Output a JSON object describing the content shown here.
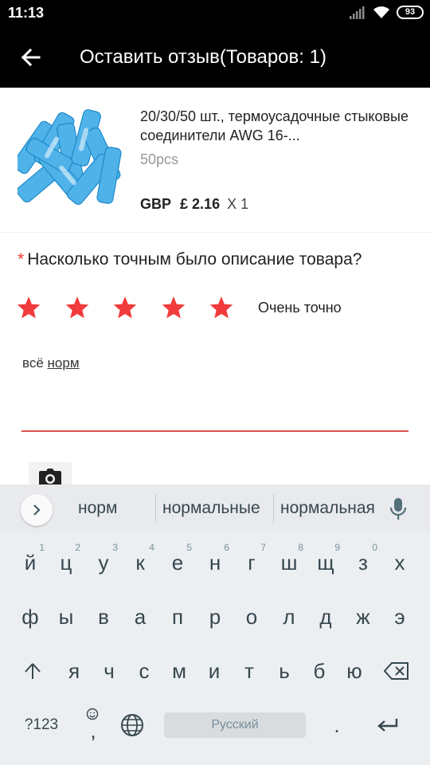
{
  "status_bar": {
    "time": "11:13",
    "battery": "93"
  },
  "app_bar": {
    "title": "Оставить отзыв(Товаров: 1)"
  },
  "product": {
    "name": "20/30/50 шт., термоусадочные стыковые соединители AWG 16-...",
    "variant": "50pcs",
    "currency": "GBP",
    "price": "£ 2.16",
    "quantity": "X 1"
  },
  "question": {
    "required_mark": "*",
    "text": "Насколько точным было описание товара?"
  },
  "rating": {
    "stars": 5,
    "max": 5,
    "label": "Очень точно",
    "star_color": "#f23b3b"
  },
  "review": {
    "text_prefix": "всё ",
    "text_underlined": "норм",
    "underline_color": "#d9534f"
  },
  "keyboard": {
    "suggestions": [
      "норм",
      "нормальные",
      "нормальная"
    ],
    "row1": [
      {
        "key": "й",
        "hint": "1"
      },
      {
        "key": "ц",
        "hint": "2"
      },
      {
        "key": "у",
        "hint": "3"
      },
      {
        "key": "к",
        "hint": "4"
      },
      {
        "key": "е",
        "hint": "5"
      },
      {
        "key": "н",
        "hint": "6"
      },
      {
        "key": "г",
        "hint": "7"
      },
      {
        "key": "ш",
        "hint": "8"
      },
      {
        "key": "щ",
        "hint": "9"
      },
      {
        "key": "з",
        "hint": "0"
      },
      {
        "key": "х",
        "hint": ""
      }
    ],
    "row2": [
      "ф",
      "ы",
      "в",
      "а",
      "п",
      "р",
      "о",
      "л",
      "д",
      "ж",
      "э"
    ],
    "row3": [
      "я",
      "ч",
      "с",
      "м",
      "и",
      "т",
      "ь",
      "б",
      "ю"
    ],
    "symbols_label": "?123",
    "comma": ",",
    "space_label": "Русский",
    "period": "."
  }
}
